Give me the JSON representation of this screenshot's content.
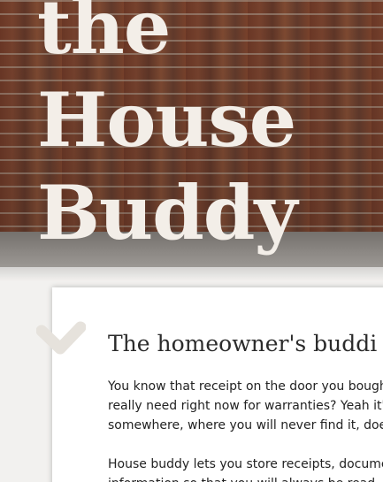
{
  "hero": {
    "title_lines": [
      "the",
      "House",
      "Buddy"
    ]
  },
  "card": {
    "icon": "checkmark-icon",
    "heading": "The homeowner's buddi",
    "paragraph1_lines": [
      "You know that receipt on the door you bough",
      "really need right now for warranties? Yeah it's",
      "somewhere, where you will never find it, does"
    ],
    "paragraph2_lines": [
      "House buddy lets you store receipts, docume",
      "information so that you will always be read"
    ]
  },
  "colors": {
    "title": "#f3eee8",
    "page_bg": "#f2f1ef",
    "card_bg": "#ffffff",
    "check": "#e6e2dc"
  }
}
